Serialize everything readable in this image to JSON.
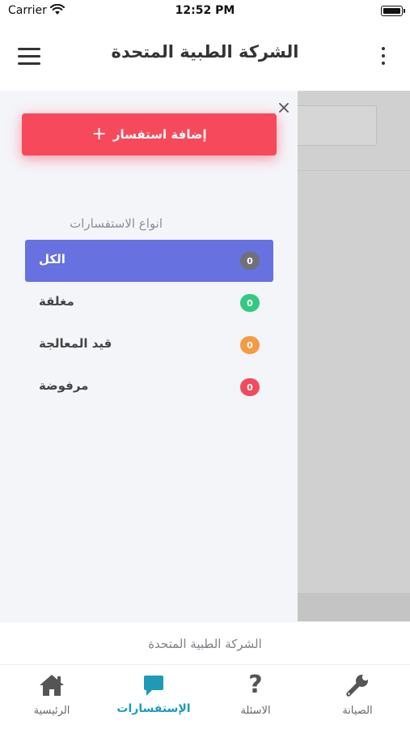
{
  "status_bar": {
    "carrier": "Carrier",
    "time": "12:52 PM"
  },
  "header": {
    "title": "الشركة الطبية المتحدة"
  },
  "drawer": {
    "add_button_label": "إضافة استفسار",
    "plus_symbol": "+",
    "types_heading": "انواع الاستفسارات",
    "types": [
      {
        "label": "الكل",
        "count": "0",
        "color": "#6f7176",
        "active": true
      },
      {
        "label": "مغلقة",
        "count": "0",
        "color": "#33c983",
        "active": false
      },
      {
        "label": "قيد المعالجة",
        "count": "0",
        "color": "#f59a45",
        "active": false
      },
      {
        "label": "مرفوضة",
        "count": "0",
        "color": "#f24a5e",
        "active": false
      }
    ]
  },
  "footer": {
    "company_name": "الشركة الطبية المتحدة"
  },
  "bottom_nav": {
    "items": [
      {
        "label": "الصيانة",
        "icon": "wrench-icon",
        "active": false
      },
      {
        "label": "الاسئلة",
        "icon": "question-icon",
        "help_glyph": "?",
        "active": false
      },
      {
        "label": "الإستفسارات",
        "icon": "chat-icon",
        "active": true
      },
      {
        "label": "الرئيسية",
        "icon": "home-icon",
        "active": false
      }
    ]
  },
  "colors": {
    "accent_red": "#f64a5c",
    "active_item": "#6771e0",
    "nav_active": "#1e9ab8",
    "drawer_bg": "#f4f5f9",
    "overlay": "#d0d0d0"
  }
}
